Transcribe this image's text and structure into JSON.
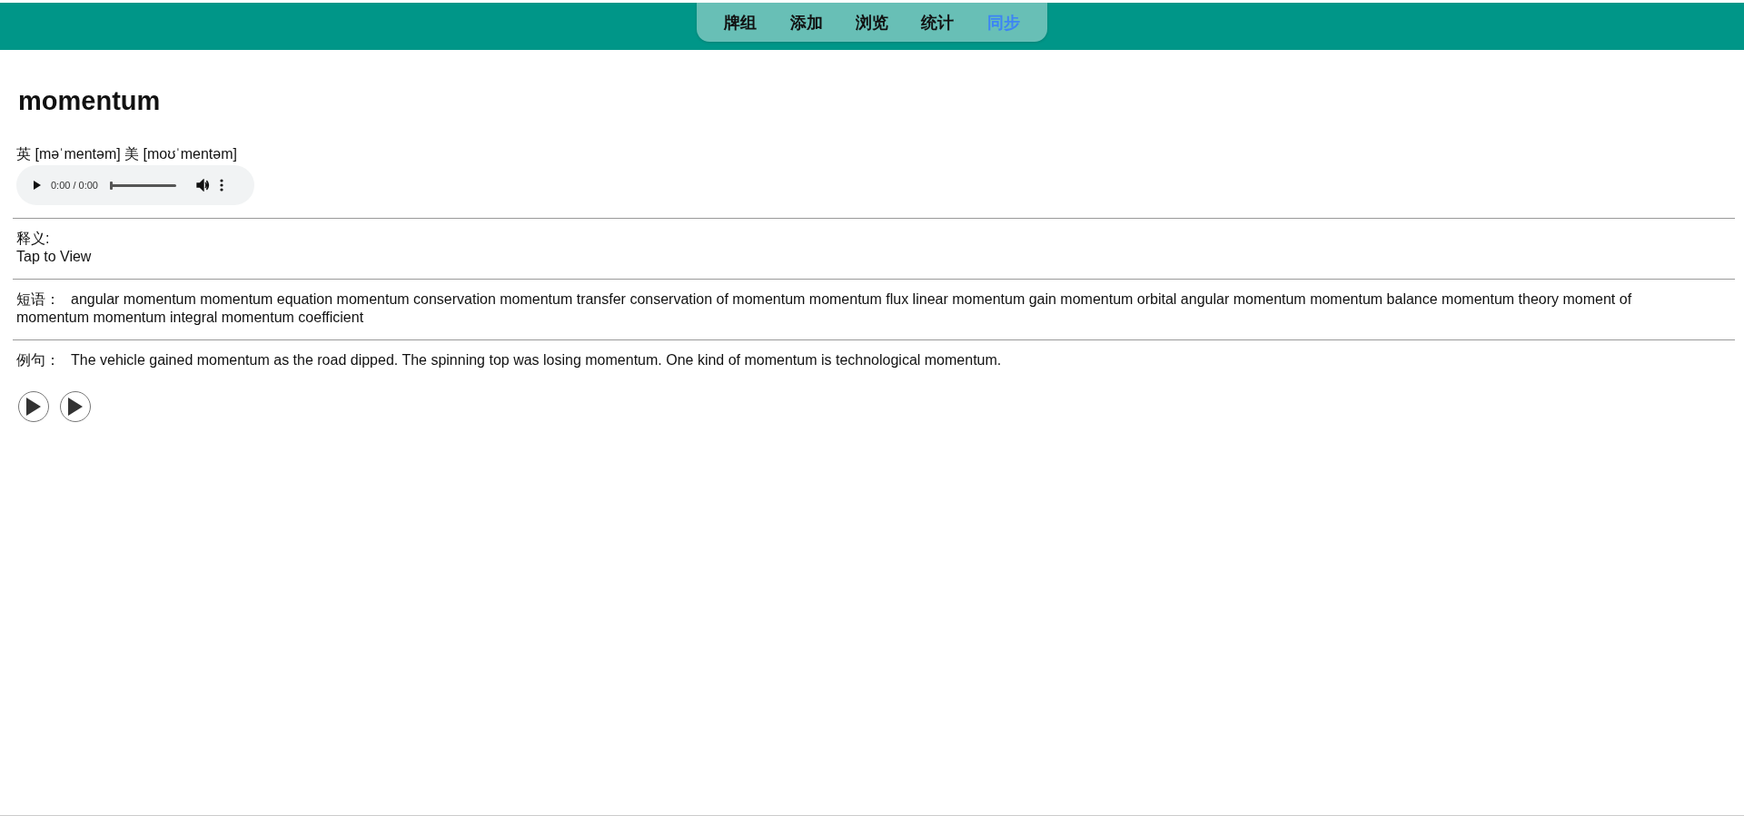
{
  "nav": {
    "tabs": [
      {
        "label": "牌组",
        "selected": false
      },
      {
        "label": "添加",
        "selected": false
      },
      {
        "label": "浏览",
        "selected": false
      },
      {
        "label": "统计",
        "selected": false
      },
      {
        "label": "同步",
        "selected": true
      }
    ]
  },
  "word": "momentum",
  "phonetic": "英 [məˈmentəm] 美 [moʊˈmentəm]",
  "audio": {
    "time": "0:00 / 0:00",
    "level": 0
  },
  "definition": {
    "label": "释义:",
    "value": "Tap to View"
  },
  "phrases": {
    "label": "短语：",
    "value": "angular momentum momentum equation momentum conservation momentum transfer conservation of momentum momentum flux linear momentum gain momentum orbital angular momentum momentum balance momentum theory moment of momentum momentum integral momentum coefficient"
  },
  "examples": {
    "label": "例句：",
    "value": "The vehicle gained momentum as the road dipped. The spinning top was losing momentum. One kind of momentum is technological momentum."
  }
}
